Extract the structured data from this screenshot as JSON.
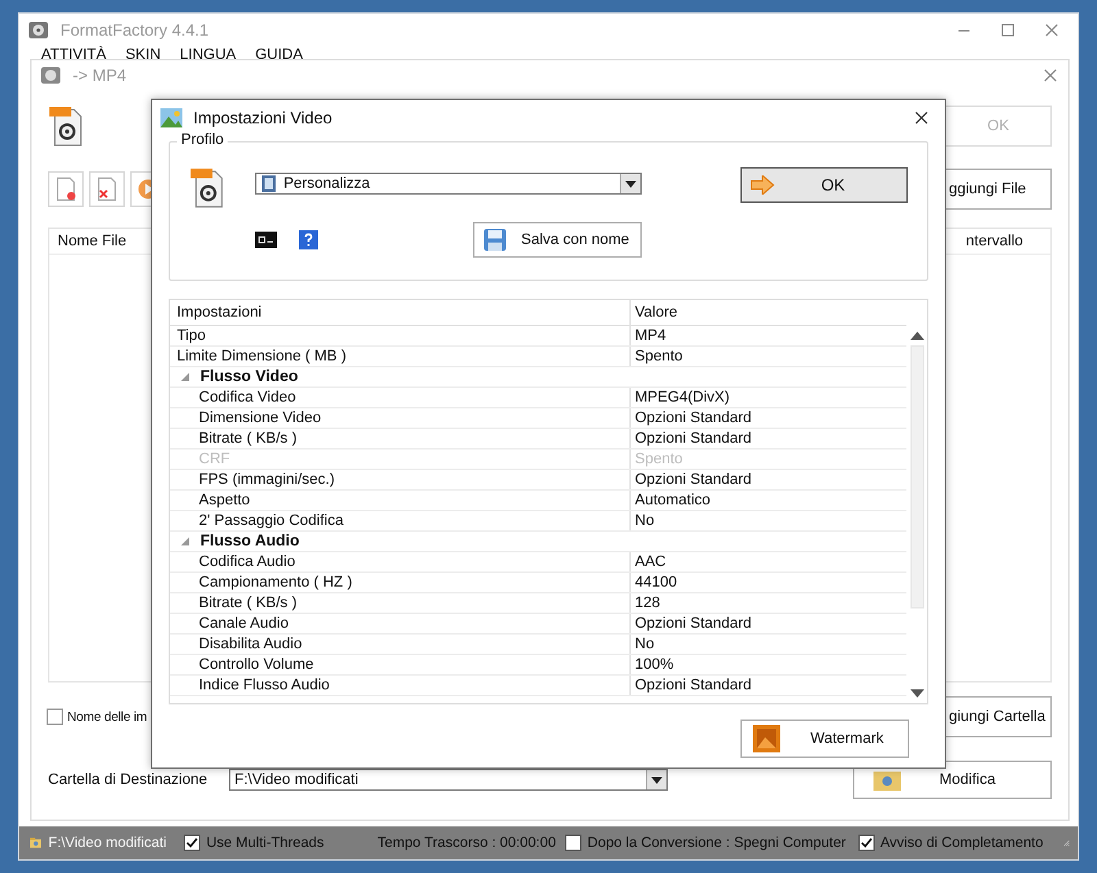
{
  "main_window": {
    "title": "FormatFactory 4.4.1",
    "menu": [
      "ATTIVITÀ",
      "SKIN",
      "LINGUA",
      "GUIDA"
    ]
  },
  "conversion_dialog": {
    "title": "-> MP4",
    "ok_button": {
      "label": "OK",
      "disabled": true
    },
    "add_file_button": "ggiungi File",
    "file_list": {
      "columns": [
        "Nome File",
        "ntervallo"
      ]
    },
    "filename_option": {
      "label": "Nome delle im",
      "checked": false
    },
    "add_folder_button": "giungi Cartella",
    "destination": {
      "label": "Cartella di Destinazione",
      "value": "F:\\Video modificati"
    },
    "modify_button": "Modifica"
  },
  "video_settings": {
    "title": "Impostazioni Video",
    "profile": {
      "legend": "Profilo",
      "value": "Personalizza"
    },
    "ok_button": "OK",
    "save_button": "Salva con nome",
    "grid": {
      "columns": [
        "Impostazioni",
        "Valore"
      ],
      "rows": [
        {
          "kind": "property",
          "name": "Tipo",
          "value": "MP4",
          "disabled": false
        },
        {
          "kind": "property",
          "name": "Limite Dimensione ( MB )",
          "value": "Spento",
          "disabled": false
        },
        {
          "kind": "category",
          "name": "Flusso Video",
          "expanded": true,
          "children": [
            {
              "kind": "property",
              "name": "Codifica Video",
              "value": "MPEG4(DivX)",
              "disabled": false
            },
            {
              "kind": "property",
              "name": "Dimensione Video",
              "value": "Opzioni Standard",
              "disabled": false
            },
            {
              "kind": "property",
              "name": "Bitrate ( KB/s )",
              "value": "Opzioni Standard",
              "disabled": false
            },
            {
              "kind": "property",
              "name": "CRF",
              "value": "Spento",
              "disabled": true
            },
            {
              "kind": "property",
              "name": "FPS (immagini/sec.)",
              "value": "Opzioni Standard",
              "disabled": false
            },
            {
              "kind": "property",
              "name": "Aspetto",
              "value": "Automatico",
              "disabled": false
            },
            {
              "kind": "property",
              "name": "2' Passaggio Codifica",
              "value": "No",
              "disabled": false
            }
          ]
        },
        {
          "kind": "category",
          "name": "Flusso Audio",
          "expanded": true,
          "children": [
            {
              "kind": "property",
              "name": "Codifica Audio",
              "value": "AAC",
              "disabled": false
            },
            {
              "kind": "property",
              "name": "Campionamento ( HZ )",
              "value": "44100",
              "disabled": false
            },
            {
              "kind": "property",
              "name": "Bitrate ( KB/s )",
              "value": "128",
              "disabled": false
            },
            {
              "kind": "property",
              "name": "Canale Audio",
              "value": "Opzioni Standard",
              "disabled": false
            },
            {
              "kind": "property",
              "name": "Disabilita Audio",
              "value": "No",
              "disabled": false
            },
            {
              "kind": "property",
              "name": "Controllo Volume",
              "value": "100%",
              "disabled": false
            },
            {
              "kind": "property",
              "name": "Indice Flusso Audio",
              "value": "Opzioni Standard",
              "disabled": false
            }
          ]
        }
      ]
    },
    "watermark_button": "Watermark"
  },
  "status_bar": {
    "folder": "F:\\Video modificati",
    "items": [
      {
        "kind": "checkbox",
        "label": "Use Multi-Threads",
        "checked": true
      },
      {
        "kind": "text",
        "label": "Tempo Trascorso : 00:00:00"
      },
      {
        "kind": "checkbox",
        "label": "Dopo la Conversione : Spegni Computer",
        "checked": false
      },
      {
        "kind": "checkbox",
        "label": "Avviso di Completamento",
        "checked": true
      }
    ]
  }
}
